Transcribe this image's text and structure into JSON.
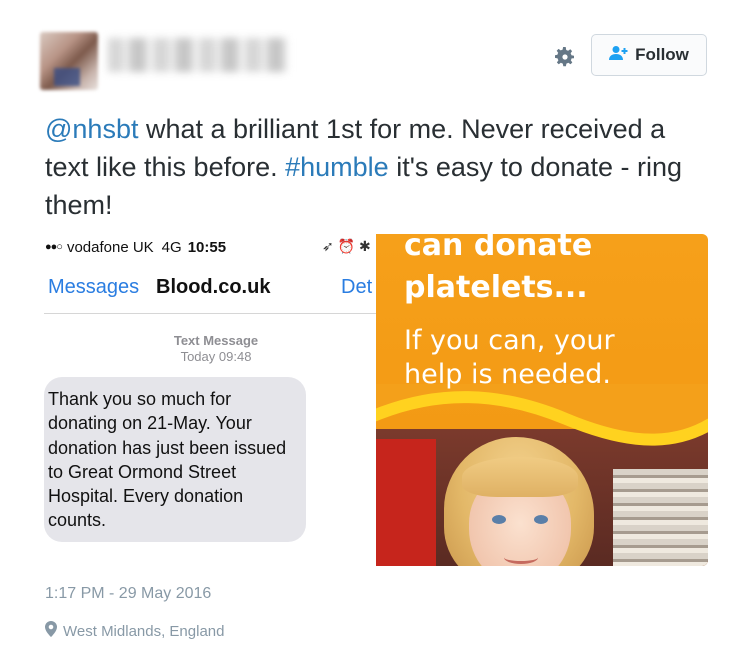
{
  "tweet": {
    "follow_label": "Follow",
    "text_parts": {
      "mention": "@nhsbt",
      "part1": " what a brilliant 1st for me. Never received a text like this before. ",
      "hashtag": "#humble",
      "part2": " it's easy to donate - ring them!"
    },
    "timestamp": "1:17 PM - 29 May 2016",
    "location": "West Midlands, England"
  },
  "phone": {
    "carrier": "vodafone UK",
    "network": "4G",
    "time": "10:55",
    "status_icons": "➶ ⏰ ✱",
    "nav_back": "Messages",
    "nav_title": "Blood.co.uk",
    "nav_right": "Det",
    "message_header": "Text Message",
    "message_day": "Today",
    "message_time": "09:48",
    "message_body": "Thank you so much for donating on 21-May. Your donation has just been issued to Great Ormond Street Hospital. Every donation counts."
  },
  "poster": {
    "line1": "can donate",
    "line2": "platelets...",
    "line3": "If you can, your",
    "line4": "help is needed."
  },
  "colors": {
    "link": "#2b7bb9",
    "ios_blue": "#2a7de1",
    "poster_orange": "#f6a01a",
    "muted": "#8899a6"
  }
}
